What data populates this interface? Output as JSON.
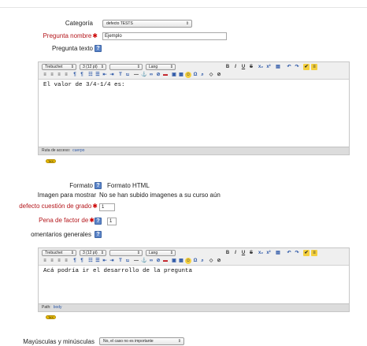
{
  "form": {
    "categoria": {
      "label": "Categoría",
      "value": "defecto TESTS"
    },
    "pregunta_nombre": {
      "label": "Pregunta nombre",
      "value": "Ejemplo"
    },
    "pregunta_texto": {
      "label": "Pregunta texto"
    },
    "formato": {
      "label": "Formato",
      "value": "Formato HTML"
    },
    "imagen": {
      "label": "Imagen para mostrar",
      "value": "No se han subido imagenes a su curso aún"
    },
    "grado": {
      "label": "defecto cuestión de grado",
      "value": "1"
    },
    "penalizacion": {
      "label": "Pena de factor de",
      "value": "1"
    },
    "comentarios": {
      "label": "omentarios generales"
    },
    "mayusculas": {
      "label": "Mayúsculas y minúsculas",
      "value": "No, el caso no es importante"
    }
  },
  "editor1": {
    "font": "Trebuchet",
    "size": "3 (12 pt)",
    "format": "",
    "lang": "Lang",
    "content": "El valor de 3/4-1/4 es:",
    "status_label": "Ruta de acceso:",
    "status_path": "cuerpo",
    "toggle": "TeX"
  },
  "editor2": {
    "font": "Trebuchet",
    "size": "3 (12 pt)",
    "format": "",
    "lang": "Lang",
    "content": "Acá podría ir el desarrollo de la pregunta",
    "status_label": "Path:",
    "status_path": "body",
    "toggle": "TeX"
  },
  "icons": {
    "help": "?",
    "required": "✱",
    "dropdown": "⇕"
  },
  "colors": {
    "required": "#cc0000",
    "label_red": "#b4161b",
    "help_blue": "#5d86c9",
    "toggle_yellow": "#e6b800"
  }
}
